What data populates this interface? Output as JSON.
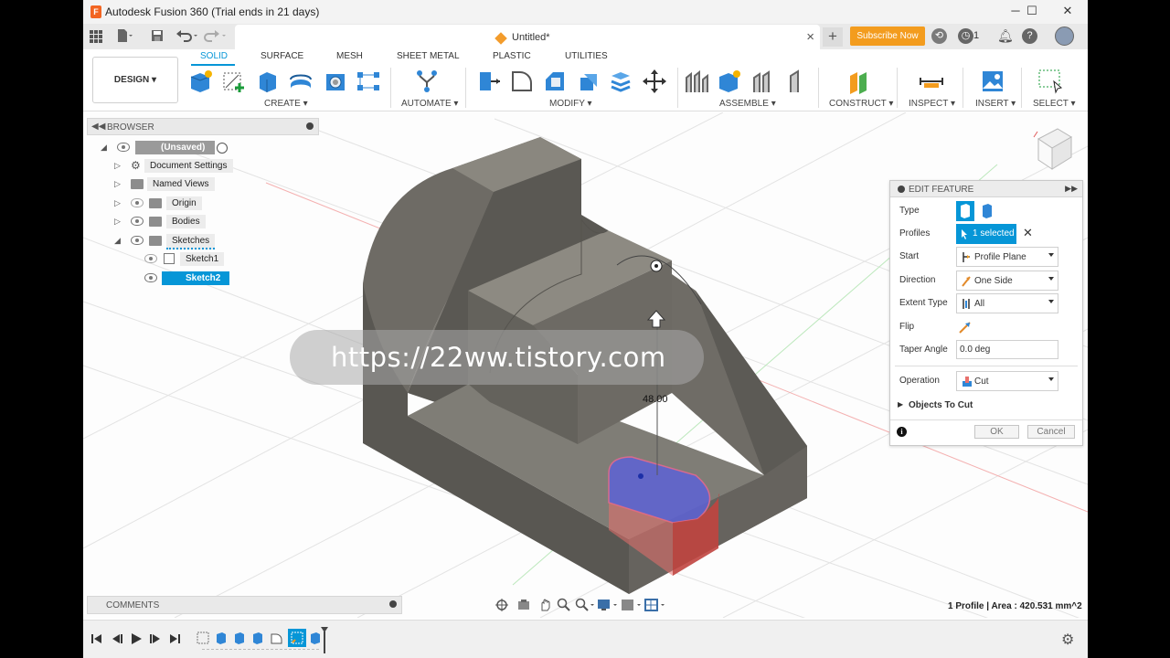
{
  "window": {
    "title": "Autodesk Fusion 360 (Trial ends in 21 days)",
    "app_icon_letter": "F",
    "minimize": "─",
    "maximize": "☐",
    "close": "✕"
  },
  "tabbar": {
    "document_name": "Untitled*",
    "close_tab": "×",
    "new_tab": "+",
    "subscribe_label": "Subscribe Now",
    "job_count": "1"
  },
  "toolbar": {
    "workspace": "DESIGN ▾",
    "tabs": [
      {
        "label": "SOLID"
      },
      {
        "label": "SURFACE"
      },
      {
        "label": "MESH"
      },
      {
        "label": "SHEET METAL"
      },
      {
        "label": "PLASTIC"
      },
      {
        "label": "UTILITIES"
      }
    ],
    "groups": [
      {
        "label": "CREATE ▾"
      },
      {
        "label": "AUTOMATE ▾"
      },
      {
        "label": "MODIFY ▾"
      },
      {
        "label": "ASSEMBLE ▾"
      },
      {
        "label": "CONSTRUCT ▾"
      },
      {
        "label": "INSPECT ▾"
      },
      {
        "label": "INSERT ▾"
      },
      {
        "label": "SELECT ▾"
      }
    ]
  },
  "browser": {
    "header": "BROWSER",
    "nodes": [
      {
        "label": "(Unsaved)"
      },
      {
        "label": "Document Settings"
      },
      {
        "label": "Named Views"
      },
      {
        "label": "Origin"
      },
      {
        "label": "Bodies"
      },
      {
        "label": "Sketches"
      },
      {
        "label": "Sketch1"
      },
      {
        "label": "Sketch2"
      }
    ]
  },
  "comments": {
    "header": "COMMENTS"
  },
  "edit_feature": {
    "header": "EDIT FEATURE",
    "type_label": "Type",
    "profiles_label": "Profiles",
    "profiles_value": "1 selected",
    "start_label": "Start",
    "start_value": "Profile Plane",
    "direction_label": "Direction",
    "direction_value": "One Side",
    "extent_label": "Extent Type",
    "extent_value": "All",
    "flip_label": "Flip",
    "taper_label": "Taper Angle",
    "taper_value": "0.0 deg",
    "operation_label": "Operation",
    "operation_value": "Cut",
    "objects_to_cut": "Objects To Cut",
    "ok": "OK",
    "cancel": "Cancel"
  },
  "viewport": {
    "dimension": "48.00",
    "status": "1 Profile | Area : 420.531 mm^2",
    "watermark": "https://22ww.tistory.com"
  },
  "colors": {
    "accent": "#0696d7",
    "subscribe": "#f39c1e",
    "body": "#6e6c66",
    "profile_blue": "#5d62d6",
    "cut_red": "#e8706c"
  }
}
